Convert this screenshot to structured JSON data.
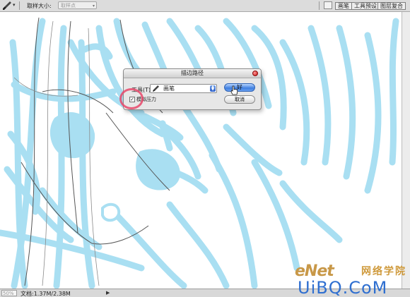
{
  "options_bar": {
    "tool_icon": "brush-icon",
    "sample_size_label": "取样大小:",
    "sample_size_value": "取样点",
    "palette_icon": "palette-well-icon",
    "well_tabs": [
      "画笔",
      "工具预设",
      "图层复合"
    ]
  },
  "dialog": {
    "title": "描边路径",
    "tool_label": "工具(T):",
    "tool_value": "画笔",
    "tool_icon": "brush-icon",
    "simulate_pressure_label": "模拟压力",
    "simulate_pressure_checked": true,
    "ok_label": "好",
    "cancel_label": "取消"
  },
  "status_bar": {
    "zoom": "50%",
    "doc_info": "文档:1.37M/2.38M",
    "arrow_icon": "play-arrow-icon"
  },
  "watermark": {
    "logo": "eNet",
    "chinese": "网络学院",
    "site": "UiBQ.CoM"
  },
  "colors": {
    "sketch_blue": "#a9dff2",
    "annotation_red": "#e8486a",
    "ok_button_blue": "#3f7fe0"
  }
}
